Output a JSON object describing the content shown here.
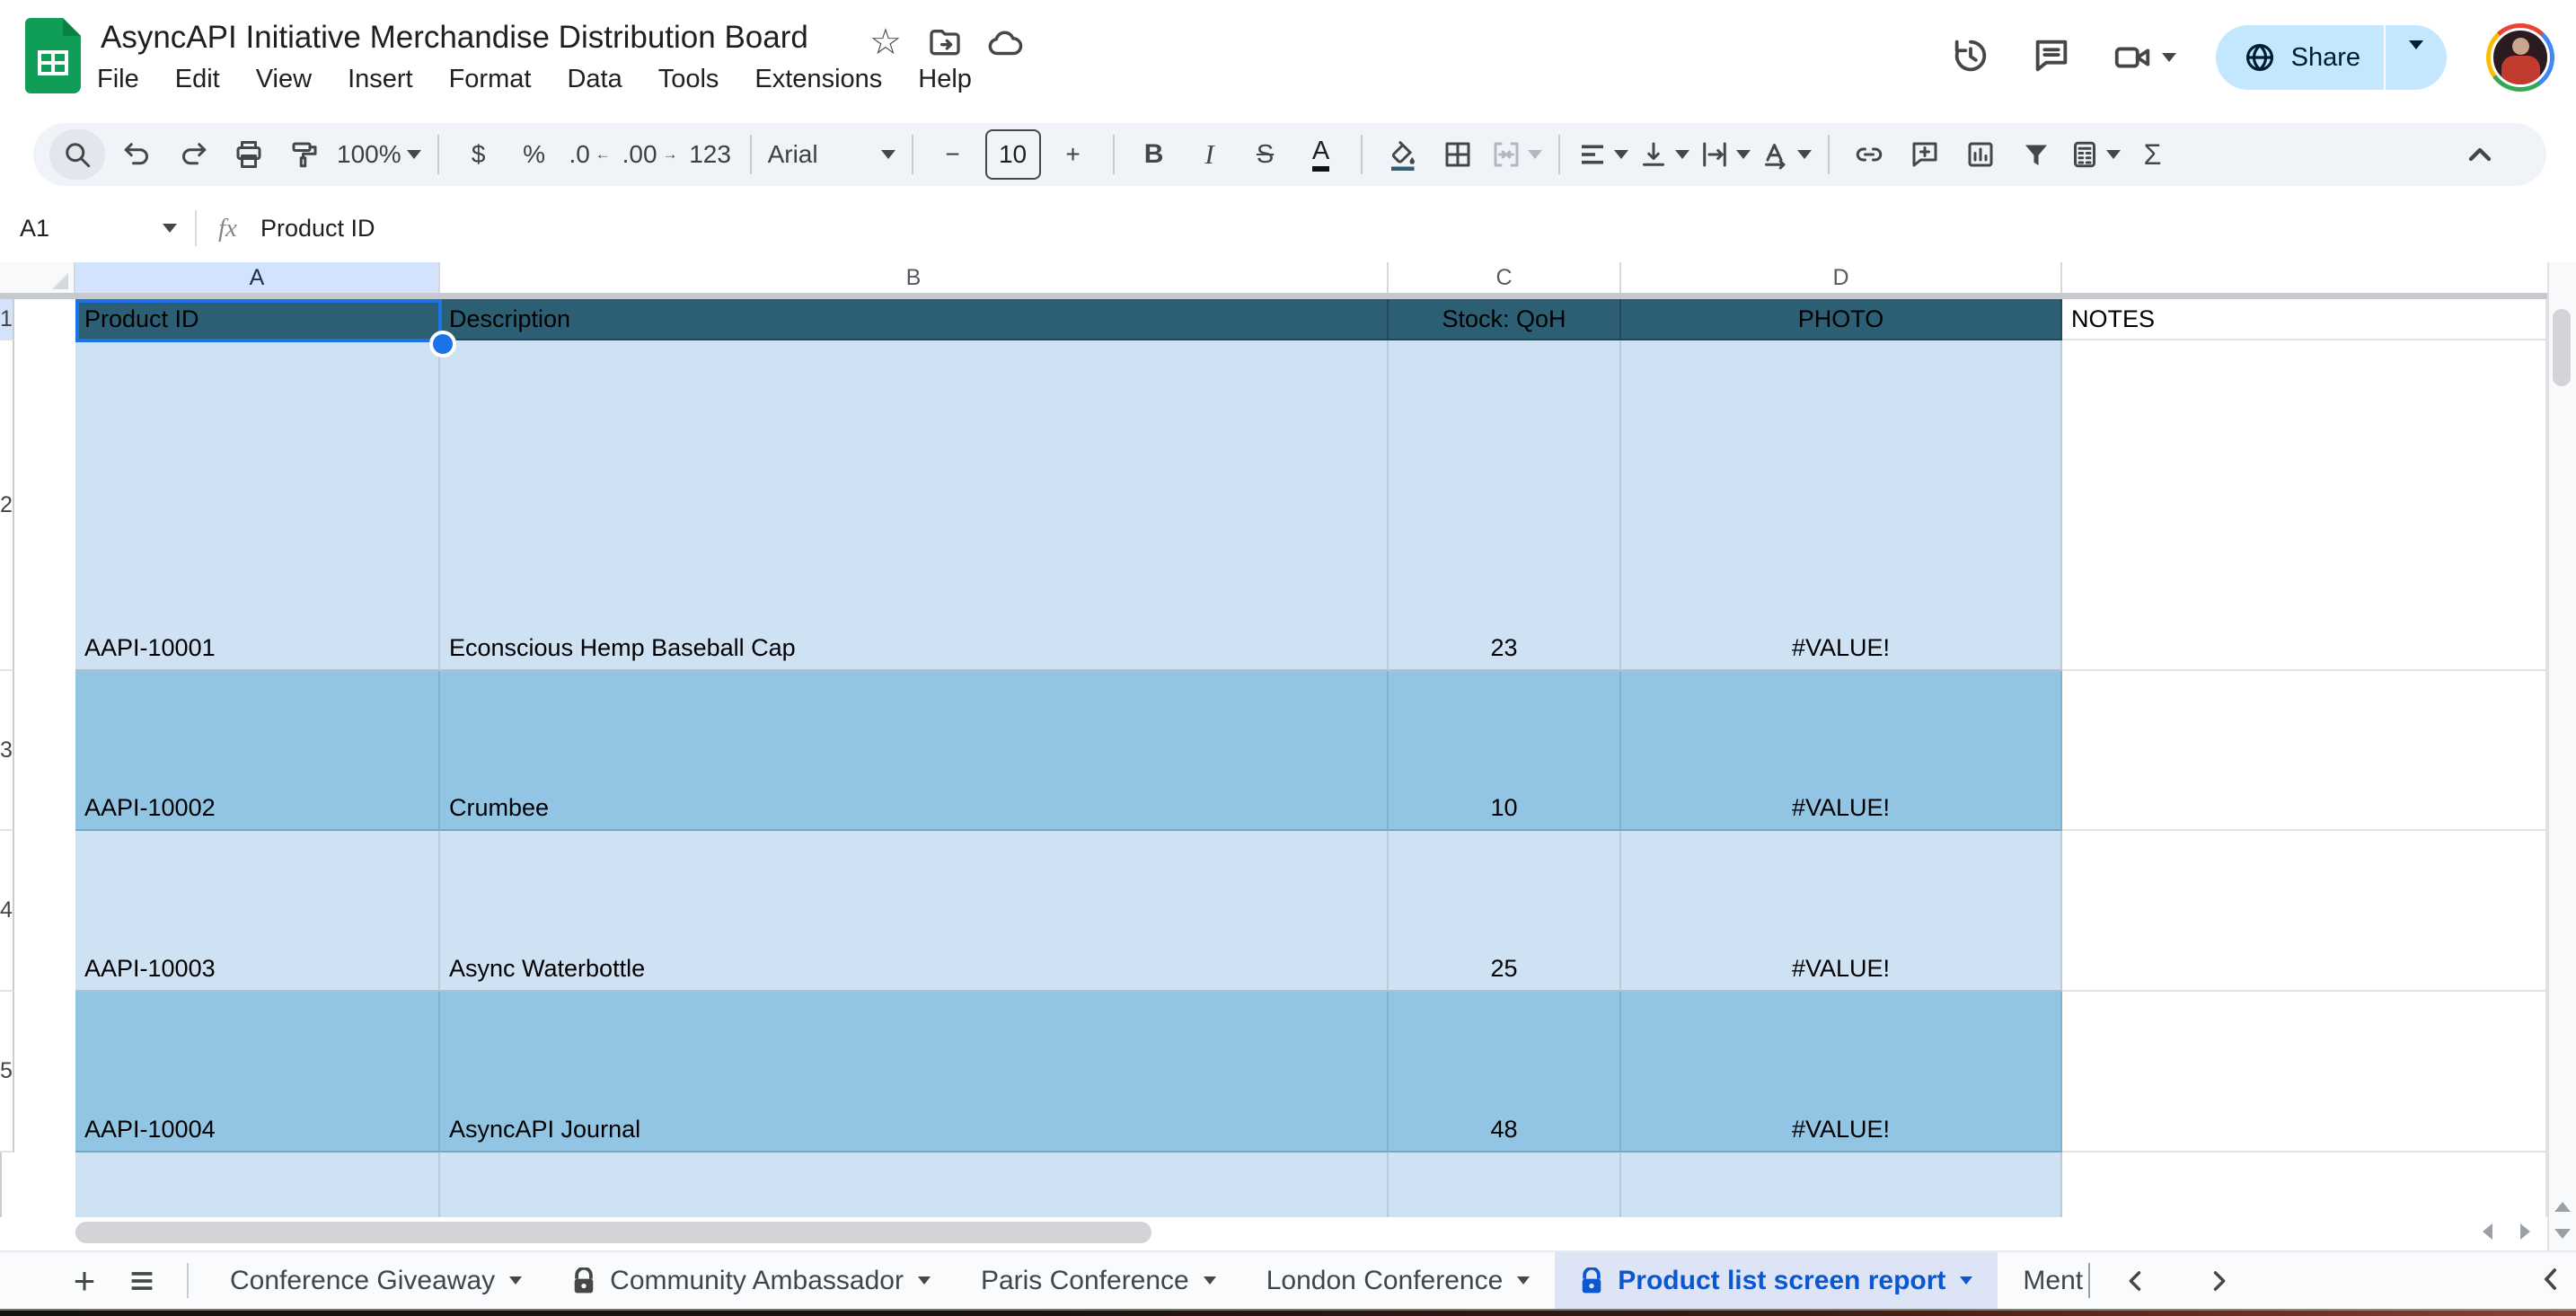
{
  "titlebar": {
    "title": "AsyncAPI Initiative Merchandise Distribution Board",
    "menus": [
      "File",
      "Edit",
      "View",
      "Insert",
      "Format",
      "Data",
      "Tools",
      "Extensions",
      "Help"
    ],
    "share_label": "Share"
  },
  "toolbar": {
    "zoom": "100%",
    "currency": "$",
    "percent": "%",
    "decrease_decimal": ".0",
    "increase_decimal": ".00",
    "more_formats": "123",
    "font": "Arial",
    "minus": "−",
    "font_size": "10",
    "plus": "+",
    "bold": "B",
    "italic": "I",
    "strikethrough": "S",
    "text_color": "A",
    "functions": "Σ"
  },
  "formula_bar": {
    "cell_ref": "A1",
    "fx_label": "fx",
    "value": "Product ID"
  },
  "grid": {
    "column_letters": [
      "A",
      "B",
      "C",
      "D"
    ],
    "header_row": {
      "row_num": "1",
      "product_id": "Product ID",
      "description": "Description",
      "stock": "Stock: QoH",
      "photo": "PHOTO",
      "notes": "NOTES"
    },
    "rows": [
      {
        "n": "2",
        "id": "AAPI-10001",
        "desc": "Econscious Hemp Baseball Cap",
        "stock": "23",
        "photo": "#VALUE!"
      },
      {
        "n": "3",
        "id": "AAPI-10002",
        "desc": "Crumbee",
        "stock": "10",
        "photo": "#VALUE!"
      },
      {
        "n": "4",
        "id": "AAPI-10003",
        "desc": "Async Waterbottle",
        "stock": "25",
        "photo": "#VALUE!"
      },
      {
        "n": "5",
        "id": "AAPI-10004",
        "desc": "AsyncAPI Journal",
        "stock": "48",
        "photo": "#VALUE!"
      }
    ]
  },
  "sheet_tabs": {
    "tabs": [
      {
        "label": "Conference Giveaway",
        "locked": false,
        "active": false
      },
      {
        "label": "Community Ambassador",
        "locked": true,
        "active": false
      },
      {
        "label": "Paris Conference",
        "locked": false,
        "active": false
      },
      {
        "label": "London Conference",
        "locked": false,
        "active": false
      },
      {
        "label": "Product list screen report",
        "locked": true,
        "active": true
      },
      {
        "label": "Ment",
        "locked": false,
        "active": false
      }
    ]
  },
  "icons": {
    "star": "☆",
    "functions": "Σ"
  },
  "colors": {
    "accent_blue": "#0b57d0",
    "selection_blue": "#1a73e8",
    "header_row_teal": "#2d5f74",
    "row_light_blue": "#cfe2f3",
    "row_medium_blue": "#92c4e3",
    "selected_header_bg": "#d3e3fd",
    "share_button_bg": "#c2e7ff",
    "toolbar_bg": "#f0f4f9",
    "active_tab_bg": "#dde4f6",
    "sheets_logo_green": "#0f9d58"
  }
}
